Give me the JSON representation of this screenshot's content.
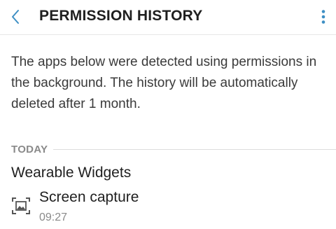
{
  "header": {
    "title": "PERMISSION HISTORY",
    "back_icon": "chevron-left-icon",
    "more_icon": "more-vert-icon",
    "accent_color": "#3e8fc4"
  },
  "description": "The apps below were detected using permissions in the background. The history will be automatically deleted after 1 month.",
  "sections": [
    {
      "label": "TODAY",
      "apps": [
        {
          "name": "Wearable Widgets",
          "permissions": [
            {
              "name": "Screen capture",
              "time": "09:27",
              "icon": "screen-capture-icon"
            }
          ]
        }
      ]
    }
  ]
}
